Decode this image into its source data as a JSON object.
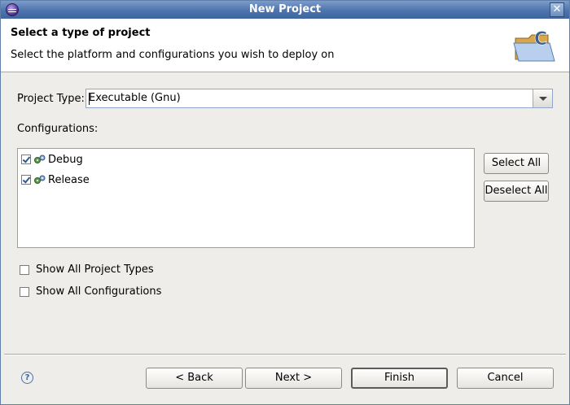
{
  "window": {
    "title": "New Project"
  },
  "banner": {
    "heading": "Select a type of project",
    "subheading": "Select the platform and configurations you wish to deploy on",
    "icon": "new-c-project-folder-icon"
  },
  "project_type": {
    "label": "Project Type:",
    "value": "Executable (Gnu)"
  },
  "configurations": {
    "label": "Configurations:",
    "items": [
      {
        "label": "Debug",
        "checked": true
      },
      {
        "label": "Release",
        "checked": true
      }
    ],
    "select_all": "Select All",
    "deselect_all": "Deselect All"
  },
  "options": {
    "show_all_project_types": {
      "label": "Show All Project Types",
      "checked": false
    },
    "show_all_configurations": {
      "label": "Show All Configurations",
      "checked": false
    }
  },
  "footer": {
    "help": "?",
    "back": "< Back",
    "next": "Next >",
    "finish": "Finish",
    "cancel": "Cancel"
  },
  "colors": {
    "titlebar": "#4d74ac",
    "banner": "#ffffff",
    "dialog_bg": "#eeede9"
  }
}
